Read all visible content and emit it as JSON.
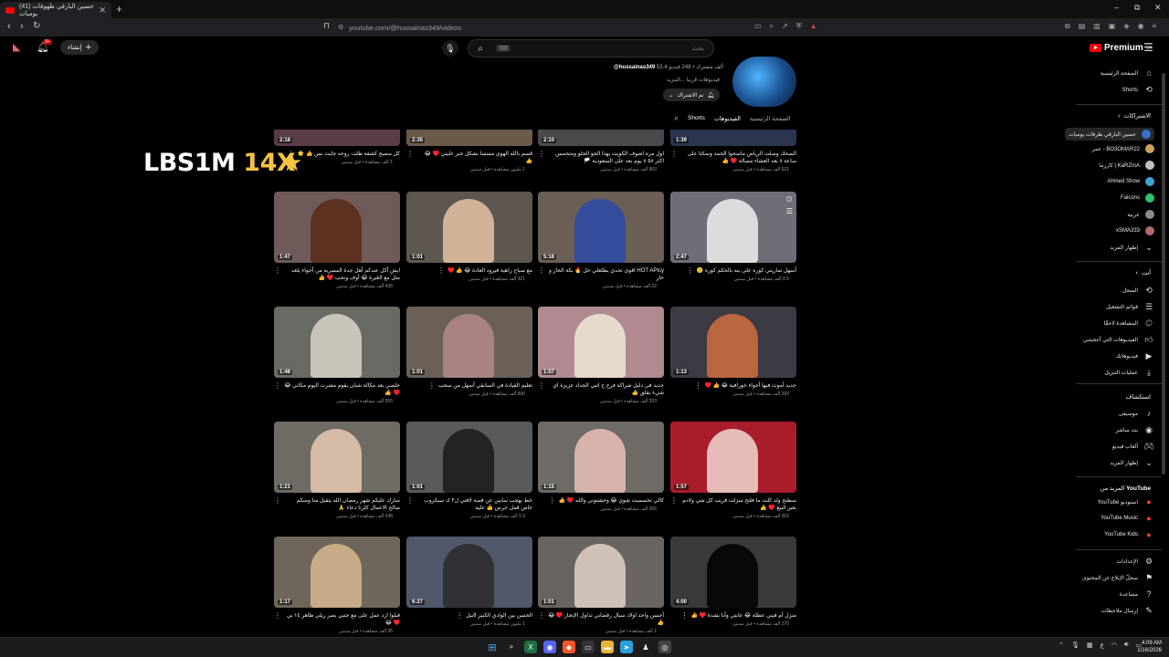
{
  "browser": {
    "tab_title": "(41) حسين البارقي ظهوفات يوميات",
    "new_tab": "+",
    "url": "youtube.com/@hussainas349/videos",
    "win_min": "–",
    "win_max": "⧉",
    "win_close": "✕"
  },
  "header": {
    "notif_count": "9+",
    "create_label": "إنشاء",
    "create_plus": "+",
    "search_placeholder": "بحث",
    "search_kbd": "⌨",
    "brand": "Premium",
    "brand_sup": "SA"
  },
  "overlay": {
    "text_main": "LBS1M",
    "text_mult": "14X",
    "star": "★"
  },
  "channel": {
    "handle": "@hussainas349",
    "stats": "53.4 ألف مشترك • 248 فيديو",
    "desc": "فيديوهات قريبا ...المزيد",
    "subscribe_label": "تم الاشتراك",
    "tabs": [
      "الصفحة الرئيسية",
      "الفيديوهات",
      "Shorts"
    ]
  },
  "videos": [
    {
      "dur": "1:39",
      "title": "الصحك وصلت الرياض ماسحوا الحمد وسكتا على ساعة ٨ بعد العشاء مسالة ♥️ 👍",
      "meta": "521 ألف مشاهدة • قبل سنتين",
      "color": "#2b3550",
      "fig": "#5a6c9a"
    },
    {
      "dur": "2:10",
      "title": "اول مره اشوف الكويت بهذا الجو الحلو ومتحمس اكثر ٥٨ ٨ يوم بعد على السعودية 🏳️",
      "meta": "963 ألف مشاهدة • قبل سنتين",
      "color": "#4a4a4a",
      "fig": "#9a9a9a"
    },
    {
      "dur": "2:35",
      "title": "قسم بالله الهوى مسمنا بشكل جبر عليني ♥️ 😂 👍",
      "meta": "1 مليون مشاهدة • قبل سنتين",
      "color": "#6b5a4a",
      "fig": "#c9a98a"
    },
    {
      "dur": "2:18",
      "title": "كل منسح كشفة ظلت روحه جايت بس 👍 🌟",
      "meta": "1 ألف مشاهدة • قبل سنتين",
      "color": "#5a3c48",
      "fig": "#d6d0d0"
    },
    {
      "dur": "2:47",
      "title": "أسهل تماريني كوره على بنه بالحكم كوره 🙂",
      "meta": "9.5 ألف مشاهدة • قبل سنتين",
      "color": "#6e6e78",
      "fig": "#f0f0f0"
    },
    {
      "dur": "5:16",
      "title": "HOT APIcy اقوى تحدي بطلعلي حل 🔥 بكة الحار و حار",
      "meta": "22 ألف مشاهدة • قبل سنتين",
      "color": "#6a5e55",
      "fig": "#2a49a8"
    },
    {
      "dur": "1:01",
      "title": "مع صباح زاهية فيرود العادة 😂 👍 ♥️",
      "meta": "321 ألف مشاهدة • قبل سنتين",
      "color": "#5e5750",
      "fig": "#e4c3a6"
    },
    {
      "dur": "1:47",
      "title": "ايش أكل عندكم أهل جدة المصرية من أجواء يلعد مثل مع الغيرة 😂 أوف وتحب ♥️ 👍",
      "meta": "436 ألف مشاهدة • قبل سنتين",
      "color": "#6e5a58",
      "fig": "#5a2a16"
    },
    {
      "dur": "1:13",
      "title": "جديد أموت فيها أجواء خورافية 😂 👍 ♥️",
      "meta": "293 ألف مشاهدة • قبل سنتين",
      "color": "#3e3a44",
      "fig": "#d07040"
    },
    {
      "dur": "1:07",
      "title": "جديد في دليل شراكة فرح ح اتبي الجداد عزيزة اي شيء بقلق 👍",
      "meta": "203 ألف مشاهدة • قبل سنتين",
      "color": "#b08a90",
      "fig": "#f0e8d8"
    },
    {
      "dur": "1:01",
      "title": "تعليم القيادة في السابقي أسهل من سحب",
      "meta": "890 ألف مشاهدة • قبل سنتين",
      "color": "#6a6058",
      "fig": "#b48a8a"
    },
    {
      "dur": "1:48",
      "title": "خلصي بعد مكالة شبان يقوم مشرت اليوم مكاني 😂 ♥️ 👍",
      "meta": "555 ألف مشاهدة • قبل سنتين",
      "color": "#6a6a64",
      "fig": "#d8d4c8"
    },
    {
      "dur": "1:57",
      "title": "سطنج ولد كلت ما فلتح منزلت قريب كل شي ولادم بعبر البيع ♥️ 👍",
      "meta": "262 ألف مشاهدة • قبل سنتين",
      "color": "#a81c2c",
      "fig": "#f0d8d0"
    },
    {
      "dur": "1:15",
      "title": "كالي تحسست شوي 😂 وحشتوني والله ♥️ 👍",
      "meta": "365 ألف مشاهدة • قبل سنتين",
      "color": "#6e6a66",
      "fig": "#e8c0b8"
    },
    {
      "dur": "1:01",
      "title": "خط بهجب سايبن عن قصة لافتي ل٣ ك سيكروب خاص قمل جرس 👍 عليه",
      "meta": "1.9 ألف مشاهدة • قبل سنتين",
      "color": "#5a5a5a",
      "fig": "#1a1a1a"
    },
    {
      "dur": "1:21",
      "title": "مبارك عليكم شهر رمضان الله يتقبل منا ومنكم صالح الاعمال كلرنا دعاء 🙏",
      "meta": "248 ألف مشاهدة • قبل سنتين",
      "color": "#6e6a64",
      "fig": "#e8c8b0"
    },
    {
      "dur": "4:00",
      "title": "منزل أم فيني عطلة 😂 عابتي وأنا بشدة ♥️ 👍",
      "meta": "270 ألف مشاهدة • قبل سنتين",
      "color": "#3a3a3a",
      "fig": "#000000"
    },
    {
      "dur": "1:01",
      "title": "أحسن واحد اولاد سيال رفضاني تداول الإنجاز ♥️ 😂 👍",
      "meta": "1 ألف مشاهدة • قبل سنتين",
      "color": "#6a6460",
      "fig": "#e0d0c8"
    },
    {
      "dur": "6:27",
      "title": "الحسن بين الوادي الكبير 8بيل",
      "meta": "1 مليون مشاهدة • قبل سنتين",
      "color": "#50586a",
      "fig": "#2a2a2a"
    },
    {
      "dur": "1:17",
      "title": "قيلوا ارد عمل على مع جتبي بصر ريلي ظاهر ١٤ بي ♥️ 😂",
      "meta": "35 ألف مشاهدة • قبل سنتين",
      "color": "#6e665a",
      "fig": "#d8b890"
    }
  ],
  "sidebar": {
    "home": "الصفحة الرئيسية",
    "shorts": "Shorts",
    "subs_head": "الاشتراكات",
    "subs": [
      {
        "label": "حسين البارقي ظرفات يوميات",
        "color": "#3a6fd0"
      },
      {
        "label": "BO3OMAR22 - عمر",
        "color": "#d0a060"
      },
      {
        "label": "KaRZmA | كارزما",
        "color": "#c0c0c0"
      },
      {
        "label": "Ahmed Show",
        "color": "#40a0d0"
      },
      {
        "label": "Falcons",
        "color": "#30c070"
      },
      {
        "label": "عربية",
        "color": "#8a8a8a"
      },
      {
        "label": "xSMA333",
        "color": "#b06a6a"
      }
    ],
    "show_more": "إظهار المزيد",
    "you_head": "أنت",
    "you_items": [
      "السجل",
      "قوائم التشغيل",
      "المشاهدة لاحقًا",
      "الفيديوهات التي أعجبتني",
      "فيديوهاتك",
      "عمليات التنزيل"
    ],
    "explore_head": "استكشاف",
    "explore_items": [
      "موسيقى",
      "بث مباشر",
      "ألعاب فيديو",
      "إظهار المزيد"
    ],
    "more_head": "المزيد من",
    "more_brand": "YouTube",
    "more_items": [
      "استوديو YouTube",
      "YouTube Music",
      "YouTube Kids"
    ],
    "footer_items": [
      "الإعدادات",
      "سجلّ الإبلاغ عن المحتوى",
      "مساعدة",
      "إرسال ملاحظات"
    ]
  },
  "taskbar": {
    "time": "4:09 AM",
    "date": "1/16/2026",
    "lang": "ع"
  }
}
